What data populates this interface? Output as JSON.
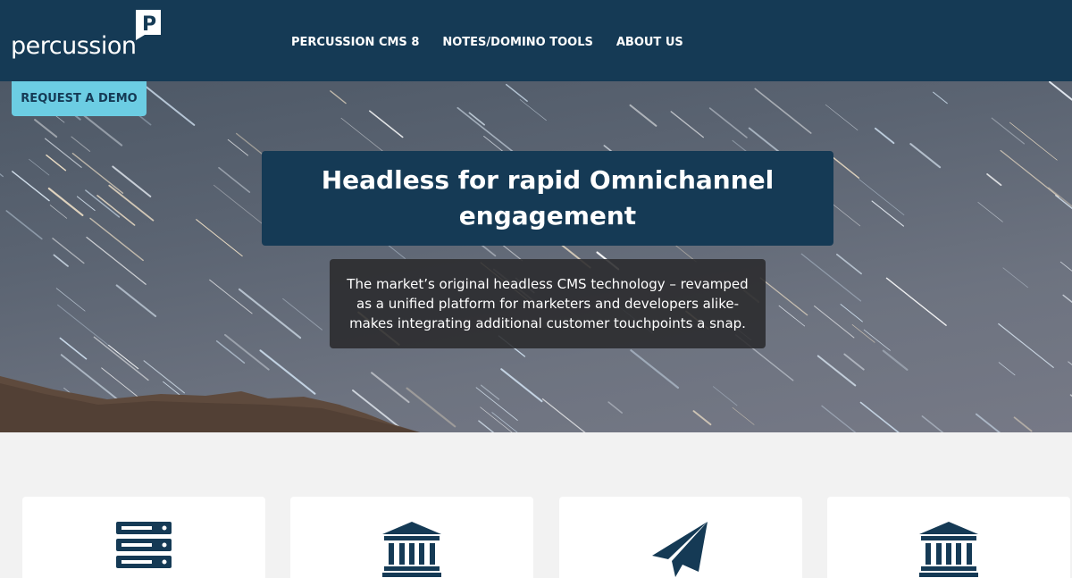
{
  "header": {
    "logo_text": "percussion",
    "logo_mark_letter": "P",
    "nav": [
      {
        "label": "PERCUSSION CMS 8"
      },
      {
        "label": "NOTES/DOMINO TOOLS"
      },
      {
        "label": "ABOUT US"
      }
    ]
  },
  "hero": {
    "cta_label": "REQUEST A DEMO",
    "headline": "Headless for rapid Omnichannel engagement",
    "subtext": "The market’s original headless CMS technology – revamped as a unified platform for marketers and developers alike- makes integrating additional customer touchpoints a snap."
  },
  "features": {
    "cards": [
      {
        "icon": "server-icon"
      },
      {
        "icon": "bank-icon"
      },
      {
        "icon": "paper-plane-icon"
      },
      {
        "icon": "bank-icon"
      }
    ]
  },
  "colors": {
    "header_bg": "#153a55",
    "cta_bg": "#6ccde3",
    "icon_color": "#153a55",
    "page_bg": "#f2f2f2"
  }
}
